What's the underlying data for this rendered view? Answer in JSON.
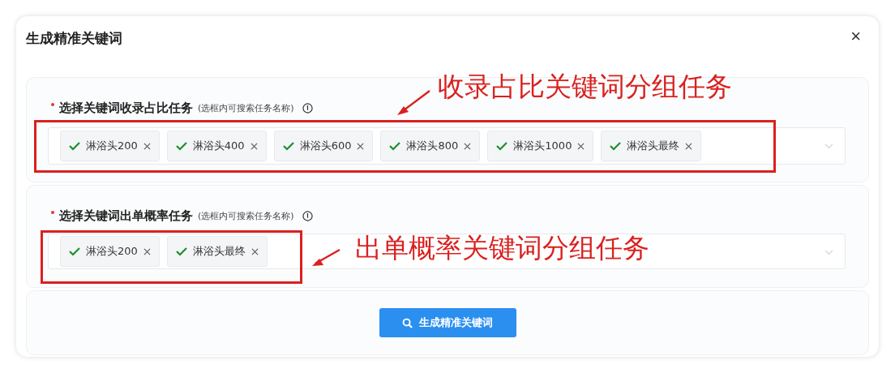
{
  "dialog": {
    "title": "生成精准关键词",
    "close": "×"
  },
  "sections": [
    {
      "required": true,
      "label": "选择关键词收录占比任务",
      "hint": "(选框内可搜索任务名称)",
      "tags": [
        "淋浴头200",
        "淋浴头400",
        "淋浴头600",
        "淋浴头800",
        "淋浴头1000",
        "淋浴头最终"
      ]
    },
    {
      "required": true,
      "label": "选择关键词出单概率任务",
      "hint": "(选框内可搜索任务名称)",
      "tags": [
        "淋浴头200",
        "淋浴头最终"
      ]
    }
  ],
  "button": {
    "label": "生成精准关键词"
  },
  "annotations": [
    {
      "text": "收录占比关键词分组任务"
    },
    {
      "text": "出单概率关键词分组任务"
    }
  ]
}
